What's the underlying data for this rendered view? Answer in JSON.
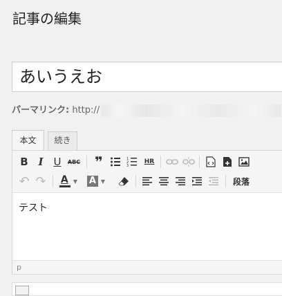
{
  "page": {
    "title": "記事の編集"
  },
  "post": {
    "title_value": "あいうえお",
    "permalink_label": "パーマリンク:",
    "permalink_prefix": "http://",
    "content": "テスト"
  },
  "editor": {
    "tabs": [
      {
        "label": "本文",
        "active": true
      },
      {
        "label": "続き",
        "active": false
      }
    ],
    "toolbar": {
      "row1": [
        {
          "name": "bold-button",
          "glyph": "B",
          "enabled": true
        },
        {
          "name": "italic-button",
          "glyph": "I",
          "enabled": true
        },
        {
          "name": "underline-button",
          "glyph": "U",
          "enabled": true
        },
        {
          "name": "strikethrough-button",
          "glyph": "ABC",
          "enabled": true
        },
        {
          "name": "blockquote-button",
          "glyph": "❞",
          "enabled": true
        },
        {
          "name": "bullet-list-button",
          "glyph": "☰",
          "enabled": true
        },
        {
          "name": "numbered-list-button",
          "glyph": "☰",
          "enabled": true
        },
        {
          "name": "horizontal-rule-button",
          "glyph": "HR",
          "enabled": true
        },
        {
          "name": "insert-link-button",
          "glyph": "⛓",
          "enabled": false
        },
        {
          "name": "remove-link-button",
          "glyph": "⛓",
          "enabled": false
        },
        {
          "name": "source-code-button",
          "glyph": "⟨⟩",
          "enabled": true
        },
        {
          "name": "insert-file-button",
          "glyph": "+",
          "enabled": true
        },
        {
          "name": "insert-image-button",
          "glyph": "▣",
          "enabled": true
        }
      ],
      "row2": [
        {
          "name": "undo-button",
          "glyph": "↶",
          "enabled": false
        },
        {
          "name": "redo-button",
          "glyph": "↷",
          "enabled": false
        },
        {
          "name": "text-color-button",
          "glyph": "A",
          "enabled": true
        },
        {
          "name": "background-color-button",
          "glyph": "A",
          "enabled": true
        },
        {
          "name": "clear-formatting-button",
          "glyph": "⌫",
          "enabled": true
        },
        {
          "name": "align-left-button",
          "glyph": "≡",
          "enabled": true
        },
        {
          "name": "align-center-button",
          "glyph": "≡",
          "enabled": true
        },
        {
          "name": "align-right-button",
          "glyph": "≡",
          "enabled": true
        },
        {
          "name": "indent-button",
          "glyph": "⇥",
          "enabled": true
        },
        {
          "name": "outdent-button",
          "glyph": "⇤",
          "enabled": false
        },
        {
          "name": "paragraph-format-button",
          "glyph": "段落",
          "enabled": true
        }
      ]
    },
    "status_path": "p"
  }
}
